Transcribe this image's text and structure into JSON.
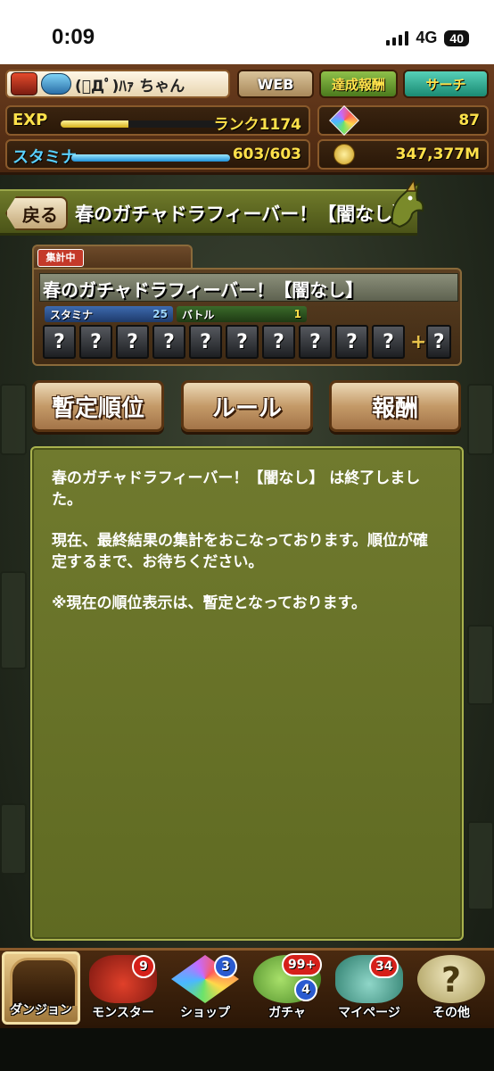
{
  "status_bar": {
    "time": "0:09",
    "network": "4G",
    "battery": "40"
  },
  "header": {
    "player_name": "(ﾟДﾟ)ﾊｧ ちゃん",
    "web_label": "WEB",
    "achievement_label": "達成報酬",
    "search_label": "サーチ",
    "exp_label": "EXP",
    "rank_label": "ランク1174",
    "exp_progress": 0.4,
    "stamina_label": "スタミナ",
    "stamina_value": "603/603",
    "stamina_progress": 1.0,
    "magic_stones": "87",
    "coins": "347,377M"
  },
  "title_bar": {
    "back_label": "戻る",
    "title": "春のガチャドラフィーバー！【闇なし】"
  },
  "event_card": {
    "status_badge": "集計中",
    "title": "春のガチャドラフィーバー！【闇なし】",
    "stamina_label": "スタミナ",
    "stamina_cost": "25",
    "battle_label": "バトル",
    "battle_count": "1",
    "slot_mark": "?",
    "helper_plus": "+"
  },
  "actions": {
    "ranking_label": "暫定順位",
    "rules_label": "ルール",
    "reward_label": "報酬"
  },
  "message": {
    "line1": "春のガチャドラフィーバー！【闇なし】 は終了しました。",
    "line2": "現在、最終結果の集計をおこなっております。順位が確定するまで、お待ちください。",
    "line3": "※現在の順位表示は、暫定となっております。"
  },
  "bottom_nav": {
    "items": [
      {
        "label": "ダンジョン"
      },
      {
        "label": "モンスター",
        "badge": "9"
      },
      {
        "label": "ショップ",
        "badge": "3"
      },
      {
        "label": "ガチャ",
        "badge": "99+",
        "badge2": "4"
      },
      {
        "label": "マイページ",
        "badge": "34"
      },
      {
        "label": "その他"
      }
    ]
  },
  "colors": {
    "title_bar": "#5c6620",
    "message_panel": "#687228",
    "button_face": "#c49a68",
    "badge_red": "#d6201a",
    "badge_blue": "#2a5ad0"
  }
}
